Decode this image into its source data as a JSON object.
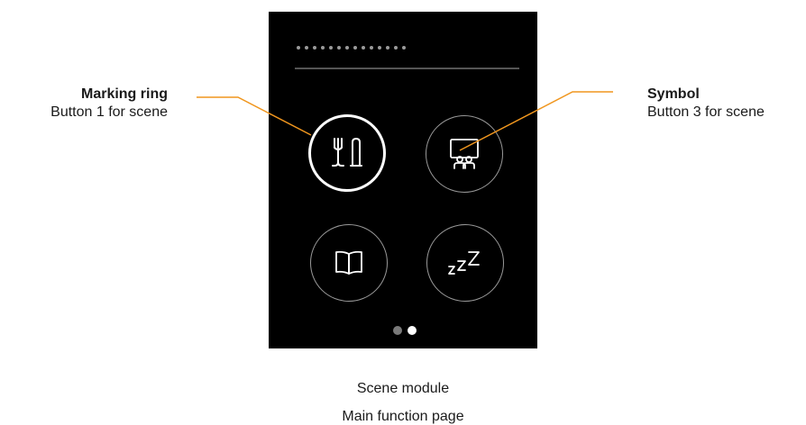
{
  "callouts": {
    "left": {
      "title": "Marking ring",
      "desc": "Button 1 for scene"
    },
    "right": {
      "title": "Symbol",
      "desc": "Button 3 for scene"
    }
  },
  "device": {
    "buttons": [
      {
        "id": 1,
        "icon": "cutlery-icon",
        "active": true
      },
      {
        "id": 3,
        "icon": "presentation-icon",
        "active": false
      },
      {
        "id": 2,
        "icon": "book-icon",
        "active": false
      },
      {
        "id": 4,
        "icon": "sleep-icon",
        "active": false
      }
    ],
    "pagination": {
      "pages": 2,
      "current": 2
    }
  },
  "caption": {
    "line1": "Scene module",
    "line2": "Main function page"
  },
  "colors": {
    "leader": "#f0961e",
    "screen": "#000000",
    "ring_active": "#ffffff",
    "ring_inactive": "#9a9a9a"
  }
}
